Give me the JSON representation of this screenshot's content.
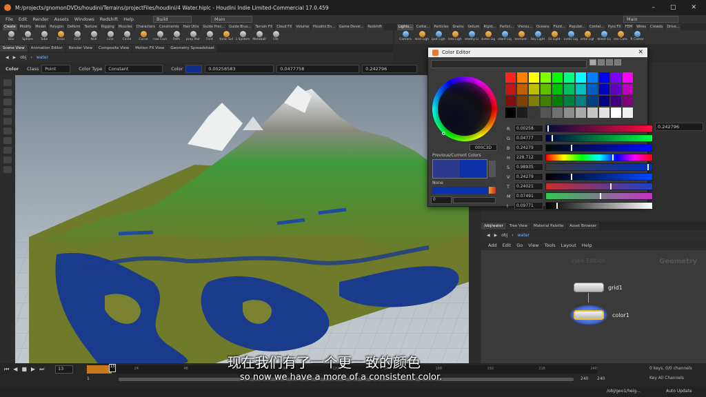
{
  "title": "M:/projects/gnomonDVDs/houdini/Terrains/projectFiles/houdini/4 Water.hiplc - Houdini Indie Limited-Commercial 17.0.459",
  "menus": [
    "File",
    "Edit",
    "Render",
    "Assets",
    "Windows",
    "Redshift",
    "Help"
  ],
  "desktop": "Build",
  "main_left": "Main",
  "main_right": "Main",
  "shelf_tabs_left": [
    "Create",
    "Modify",
    "Model",
    "Polygon",
    "Deform",
    "Texture",
    "Rigging",
    "Muscles",
    "Characters",
    "Constraints",
    "Hair Utils",
    "Guide Proc...",
    "Guide Brus...",
    "Terrain FX",
    "Cloud FX",
    "Volume",
    "Houdini En...",
    "Game Devel...",
    "Redshift"
  ],
  "shelf_tabs_right": [
    "Lights...",
    "Collisi...",
    "Particles",
    "Grains",
    "Vellum",
    "Rigid...",
    "Particl...",
    "Viscou...",
    "Oceans",
    "Fluid...",
    "Populat...",
    "Contai...",
    "Pyro FX",
    "FEM",
    "Wires",
    "Crowds",
    "Drive..."
  ],
  "tools_left": [
    "Box",
    "Sphere",
    "Tube",
    "Torus",
    "Grid",
    "Null",
    "Line",
    "Circle",
    "Curve",
    "Draw Curve",
    "Path",
    "Spray Paint",
    "Font",
    "Platonic Solids",
    "L-System",
    "Metaball",
    "File"
  ],
  "tools_right": [
    "Camera",
    "Point Light",
    "Spot Light",
    "Area Light",
    "Geometry Light",
    "Volume Light",
    "Distant Light",
    "Environment Light",
    "Sky Light",
    "GI Light",
    "Caustic Light",
    "Portal Light",
    "Ambient Light",
    "Stereo Camera",
    "VR Camera"
  ],
  "pane_tabs": [
    "Scene View",
    "Animation Editor",
    "Render View",
    "Composite View",
    "Motion FX View",
    "Geometry Spreadsheet"
  ],
  "path": {
    "obj": "obj",
    "node": "water"
  },
  "param": {
    "name_label": "Color",
    "class_label": "Class",
    "class_value": "Point",
    "type_label": "Color Type",
    "type_value": "Constant",
    "color_label": "Color",
    "r": "0.00258583",
    "g": "0.0477758",
    "b": "0.242796",
    "right_b": "0.242796"
  },
  "color_editor": {
    "title": "Color Editor",
    "hex": "000C3D",
    "prev_label": "Previous/Current Colors",
    "none_label": "None",
    "alpha": "0",
    "rows": [
      {
        "label": "R",
        "value": "0.00258",
        "pos": 0.01,
        "grad": "linear-gradient(90deg,#000c3d,#ff0c3d)"
      },
      {
        "label": "G",
        "value": "0.04777",
        "pos": 0.05,
        "grad": "linear-gradient(90deg,#000040,#00ff40)"
      },
      {
        "label": "B",
        "value": "0.24279",
        "pos": 0.24,
        "grad": "linear-gradient(90deg,#000c00,#000cff)"
      },
      {
        "label": "H",
        "value": "228.712",
        "pos": 0.64,
        "grad": "linear-gradient(90deg,red,yellow,lime,cyan,blue,magenta,red)"
      },
      {
        "label": "S",
        "value": "0.98935",
        "pos": 0.98,
        "grad": "linear-gradient(90deg,#3a3a3a,#0030c0)"
      },
      {
        "label": "V",
        "value": "0.24279",
        "pos": 0.24,
        "grad": "linear-gradient(90deg,#000,#0048ff)"
      },
      {
        "label": "T",
        "value": "0.24021",
        "pos": 0.62,
        "grad": "linear-gradient(90deg,#c83030,#1e40c8)"
      },
      {
        "label": "M",
        "value": "0.07491",
        "pos": 0.52,
        "grad": "linear-gradient(90deg,#30c850,#c830c8)"
      },
      {
        "label": "I",
        "value": "0.09771",
        "pos": 0.1,
        "grad": "linear-gradient(90deg,#000,#fff)"
      }
    ],
    "swatches": [
      "#ff2020",
      "#ff8000",
      "#ffff00",
      "#80ff00",
      "#00ff00",
      "#00ff80",
      "#00ffff",
      "#0080ff",
      "#0000ff",
      "#8000ff",
      "#ff00ff",
      "#c01818",
      "#c06000",
      "#c0c000",
      "#60c000",
      "#00c000",
      "#00c060",
      "#00c0c0",
      "#0060c0",
      "#0000c0",
      "#6000c0",
      "#c000c0",
      "#801010",
      "#804000",
      "#808000",
      "#408000",
      "#008000",
      "#008040",
      "#008080",
      "#004080",
      "#000080",
      "#400080",
      "#800080",
      "#000000",
      "#1c1c1c",
      "#383838",
      "#555555",
      "#717171",
      "#8d8d8d",
      "#aaaaaa",
      "#c6c6c6",
      "#e2e2e2",
      "#ffffff",
      "#f0f0f0"
    ]
  },
  "net": {
    "tabs": [
      "/obj/water",
      "Tree View",
      "Material Palette",
      "Asset Browser"
    ],
    "path_obj": "obj",
    "path_node": "water",
    "menu": [
      "Add",
      "Edit",
      "Go",
      "View",
      "Tools",
      "Layout",
      "Help"
    ],
    "watermark_left": "Indie Edition",
    "watermark_right": "Geometry",
    "nodes": [
      "grid1",
      "color1"
    ]
  },
  "timeline": {
    "frame": "13",
    "marker": "13",
    "start": "1",
    "end": "240",
    "end2": "240",
    "ticks": [
      "1",
      "24",
      "48",
      "72",
      "96",
      "120",
      "144",
      "168",
      "192",
      "216",
      "240"
    ],
    "keys": "0 keys, 0/0 channels",
    "key_all": "Key All Channels",
    "auto_update": "Auto Update",
    "status_path": "/obj/geo1/heig..."
  },
  "subtitle": {
    "cn": "现在我们有了一个更一致的颜色",
    "en": "so now we have a more of a consistent color."
  }
}
